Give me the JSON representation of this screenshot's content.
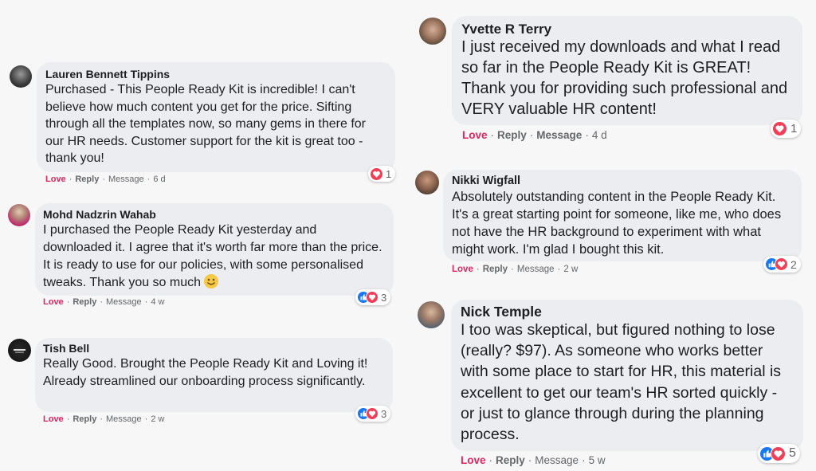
{
  "comments": [
    {
      "name": "Lauren Bennett Tippins",
      "text": "Purchased - This People Ready Kit is incredible! I can't believe how much content you get for the price. Sifting through all the templates now, so many gems in there  for our HR needs. Customer support for the kit is great too - thank you!",
      "love": "Love",
      "reply": "Reply",
      "message": "Message",
      "time": "6 d",
      "reaction_count": "1",
      "reaction_icons": [
        "heart-icon"
      ]
    },
    {
      "name": "Mohd Nadzrin Wahab",
      "text": "I purchased the People Ready Kit yesterday and downloaded it. I agree that it's worth far more than the price. It is ready to use for our policies, with some personalised tweaks. Thank you so much",
      "love": "Love",
      "reply": "Reply",
      "message": "Message",
      "time": "4 w",
      "reaction_count": "3",
      "reaction_icons": [
        "like-icon",
        "heart-icon"
      ]
    },
    {
      "name": "Tish Bell",
      "text": "Really Good. Brought the People Ready Kit and Loving it! Already streamlined our onboarding process significantly.",
      "love": "Love",
      "reply": "Reply",
      "message": "Message",
      "time": "2 w",
      "reaction_count": "3",
      "reaction_icons": [
        "like-icon",
        "heart-icon"
      ]
    },
    {
      "name": "Yvette R Terry",
      "text": "I just received my downloads and what I read so far in the People Ready Kit is GREAT! Thank you for providing such professional and VERY valuable HR content!",
      "love": "Love",
      "reply": "Reply",
      "message": "Message",
      "time": "4 d",
      "reaction_count": "1",
      "reaction_icons": [
        "heart-icon"
      ]
    },
    {
      "name": "Nikki Wigfall",
      "text": "Absolutely outstanding content in the People Ready Kit. It's a great starting point for someone, like me, who does not have the HR background to experiment with what might work. I'm glad I bought this kit.",
      "love": "Love",
      "reply": "Reply",
      "message": "Message",
      "time": "2 w",
      "reaction_count": "2",
      "reaction_icons": [
        "like-icon",
        "heart-icon"
      ]
    },
    {
      "name": "Nick Temple",
      "text": "I too was skeptical, but figured nothing to lose (really? $97). As someone who works better with some place to start for HR, this material is excellent to get our team's HR sorted quickly - or just to glance through during the planning process.",
      "love": "Love",
      "reply": "Reply",
      "message": "Message",
      "time": "5 w",
      "reaction_count": "5",
      "reaction_icons": [
        "like-icon",
        "heart-icon"
      ]
    }
  ],
  "colors": {
    "love": "#e0245e",
    "like": "#1877f2",
    "heart": "#f33e58",
    "bubble": "#ecedf0"
  }
}
